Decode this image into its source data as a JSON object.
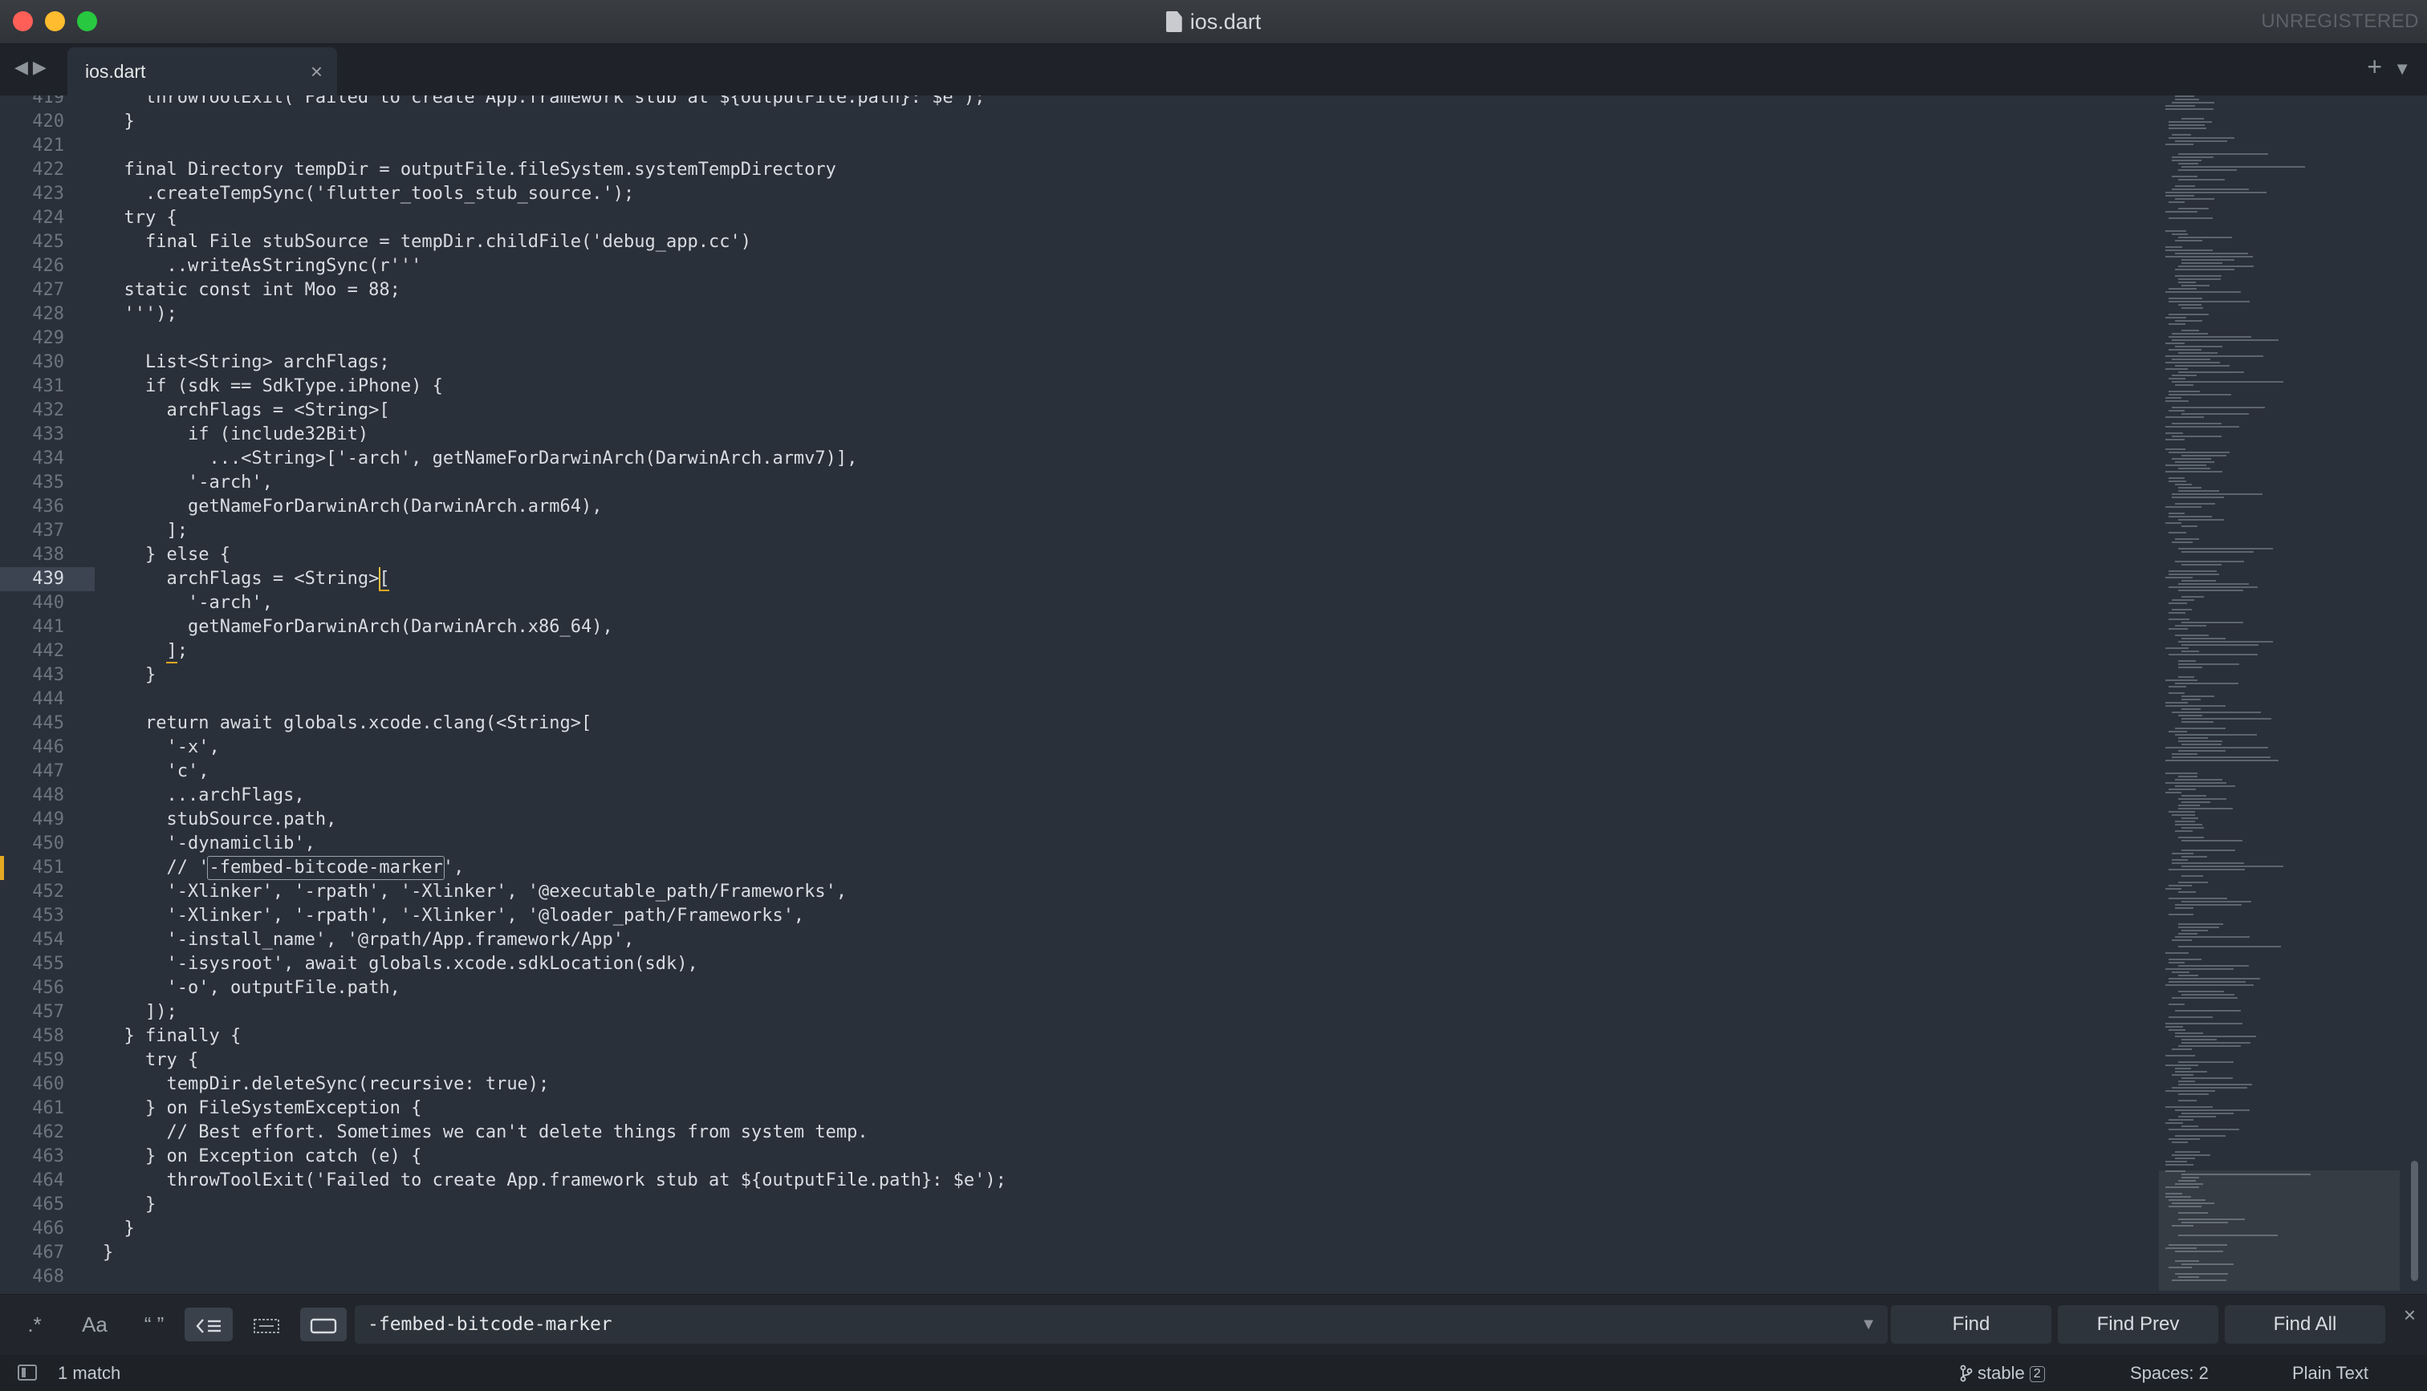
{
  "window": {
    "title": "ios.dart",
    "unregistered_label": "UNREGISTERED"
  },
  "tabs": [
    {
      "label": "ios.dart",
      "close_glyph": "×",
      "active": true
    }
  ],
  "editor": {
    "first_line_number": 419,
    "active_line": 439,
    "lines": [
      "    throwToolExit('Failed to create App.framework stub at ${outputFile.path}: $e');",
      "  }",
      "",
      "  final Directory tempDir = outputFile.fileSystem.systemTempDirectory",
      "    .createTempSync('flutter_tools_stub_source.');",
      "  try {",
      "    final File stubSource = tempDir.childFile('debug_app.cc')",
      "      ..writeAsStringSync(r'''",
      "  static const int Moo = 88;",
      "  ''');",
      "",
      "    List<String> archFlags;",
      "    if (sdk == SdkType.iPhone) {",
      "      archFlags = <String>[",
      "        if (include32Bit)",
      "          ...<String>['-arch', getNameForDarwinArch(DarwinArch.armv7)],",
      "        '-arch',",
      "        getNameForDarwinArch(DarwinArch.arm64),",
      "      ];",
      "    } else {",
      "      archFlags = <String>[",
      "        '-arch',",
      "        getNameForDarwinArch(DarwinArch.x86_64),",
      "      ];",
      "    }",
      "",
      "    return await globals.xcode.clang(<String>[",
      "      '-x',",
      "      'c',",
      "      ...archFlags,",
      "      stubSource.path,",
      "      '-dynamiclib',",
      "      // '-fembed-bitcode-marker',",
      "      '-Xlinker', '-rpath', '-Xlinker', '@executable_path/Frameworks',",
      "      '-Xlinker', '-rpath', '-Xlinker', '@loader_path/Frameworks',",
      "      '-install_name', '@rpath/App.framework/App',",
      "      '-isysroot', await globals.xcode.sdkLocation(sdk),",
      "      '-o', outputFile.path,",
      "    ]);",
      "  } finally {",
      "    try {",
      "      tempDir.deleteSync(recursive: true);",
      "    } on FileSystemException {",
      "      // Best effort. Sometimes we can't delete things from system temp.",
      "    } on Exception catch (e) {",
      "      throwToolExit('Failed to create App.framework stub at ${outputFile.path}: $e');",
      "    }",
      "  }",
      "}",
      ""
    ]
  },
  "find_panel": {
    "regex_toggle": ".*",
    "case_toggle": "Aa",
    "whole_word_toggle": "“ ”",
    "query": "-fembed-bitcode-marker",
    "find_label": "Find",
    "find_prev_label": "Find Prev",
    "find_all_label": "Find All",
    "close_glyph": "×"
  },
  "status_bar": {
    "match_count": "1 match",
    "branch": "stable",
    "branch_badge": "2",
    "indentation": "Spaces: 2",
    "syntax": "Plain Text"
  }
}
